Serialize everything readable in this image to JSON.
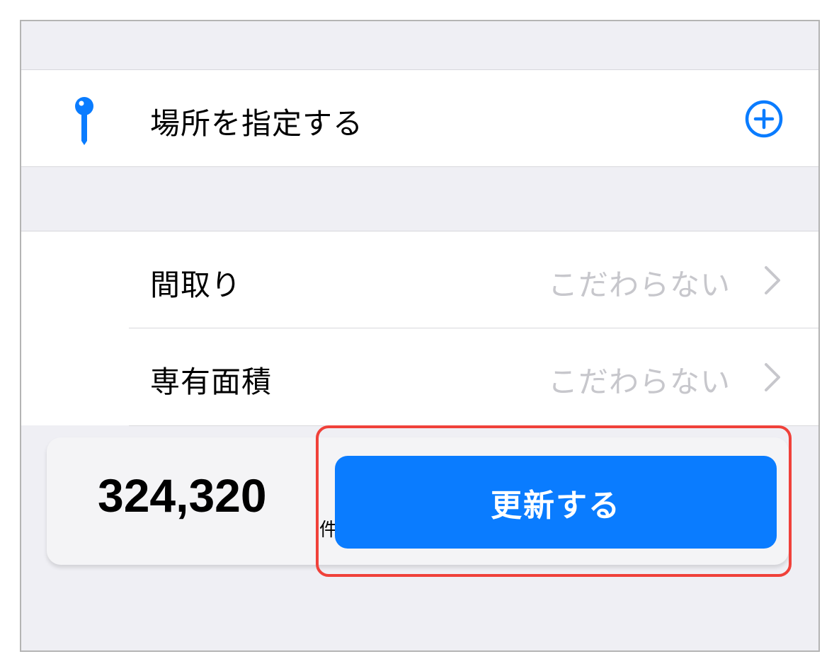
{
  "location_row": {
    "label": "場所を指定する",
    "pin_icon": "location-pin-icon",
    "add_icon": "add-circle-icon"
  },
  "filters": [
    {
      "label": "間取り",
      "value": "こだわらない"
    },
    {
      "label": "専有面積",
      "value": "こだわらない"
    }
  ],
  "results": {
    "count": "324,320",
    "unit": "件"
  },
  "update_button": {
    "label": "更新する"
  },
  "colors": {
    "accent": "#0a7cff",
    "highlight": "#f0413a",
    "placeholder_text": "#c7c7cc",
    "background": "#efeff4"
  }
}
